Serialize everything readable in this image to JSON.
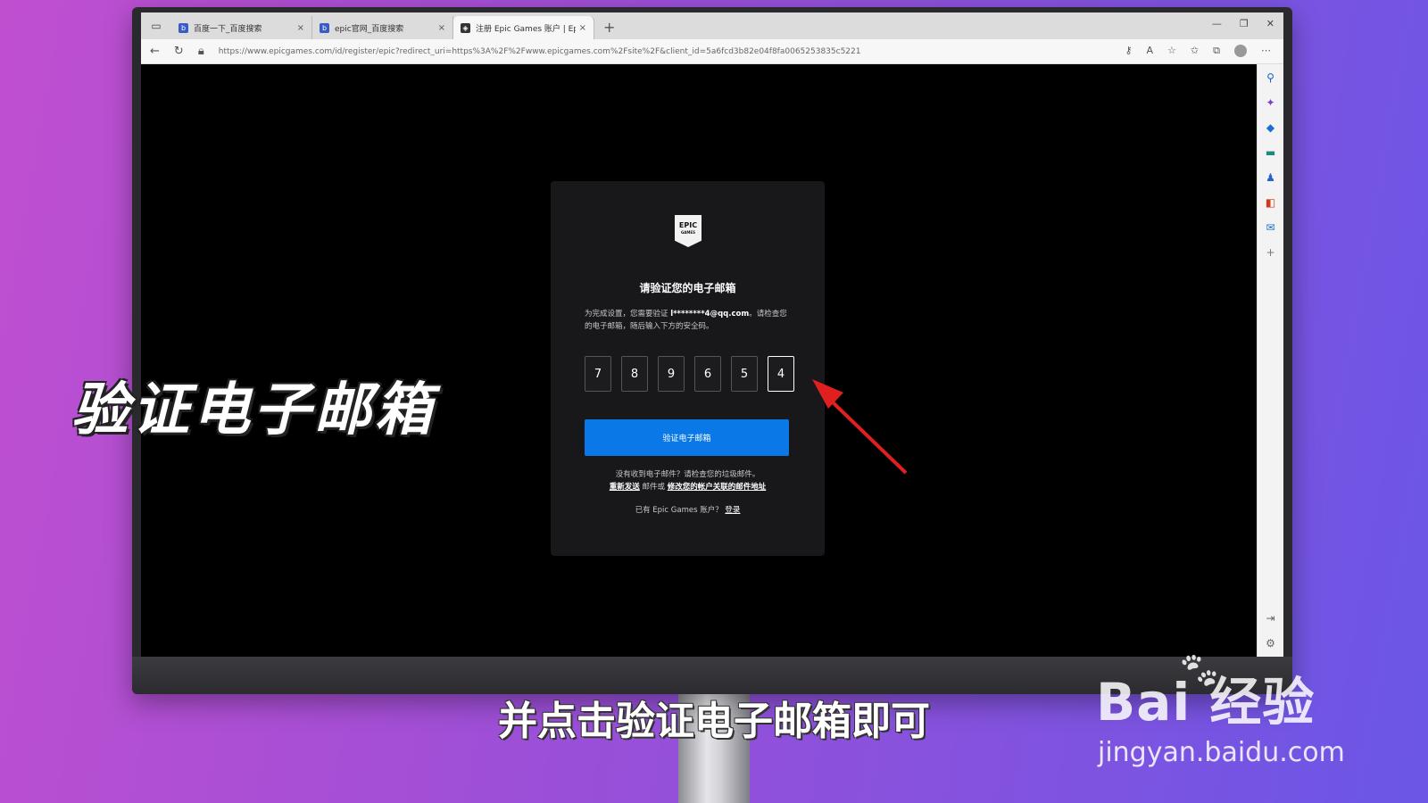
{
  "browser": {
    "tabs": [
      {
        "title": "百度一下_百度搜索",
        "close": "×"
      },
      {
        "title": "epic官网_百度搜索",
        "close": "×"
      },
      {
        "title": "注册 Epic Games 账户 | Epic Gam",
        "close": "×"
      }
    ],
    "new_tab": "+",
    "url": "https://www.epicgames.com/id/register/epic?redirect_uri=https%3A%2F%2Fwww.epicgames.com%2Fsite%2F&client_id=5a6fcd3b82e04f8fa0065253835c5221"
  },
  "page": {
    "logo_text": "EPIC",
    "logo_sub": "GAMES",
    "heading": "请验证您的电子邮箱",
    "instruction_pre": "为完成设置，您需要验证 ",
    "email": "l********4@qq.com",
    "instruction_post": "。请检查您的电子邮箱，随后输入下方的安全码。",
    "code": [
      "7",
      "8",
      "9",
      "6",
      "5",
      "4"
    ],
    "verify_button": "验证电子邮箱",
    "resend_text": "没有收到电子邮件？请检查您的垃圾邮件。",
    "resend_link": "重新发送",
    "or_text": " 邮件或 ",
    "change_link": "修改您的帐户关联的邮件地址",
    "signin_text": "已有 Epic Games 账户？",
    "signin_link": "登录"
  },
  "overlay": {
    "left_caption": "验证电子邮箱",
    "subtitle": "并点击验证电子邮箱即可",
    "watermark_brand": "Bai  经验",
    "watermark_url": "jingyan.baidu.com"
  },
  "colors": {
    "accent": "#0a78e6",
    "arrow": "#e02020"
  }
}
